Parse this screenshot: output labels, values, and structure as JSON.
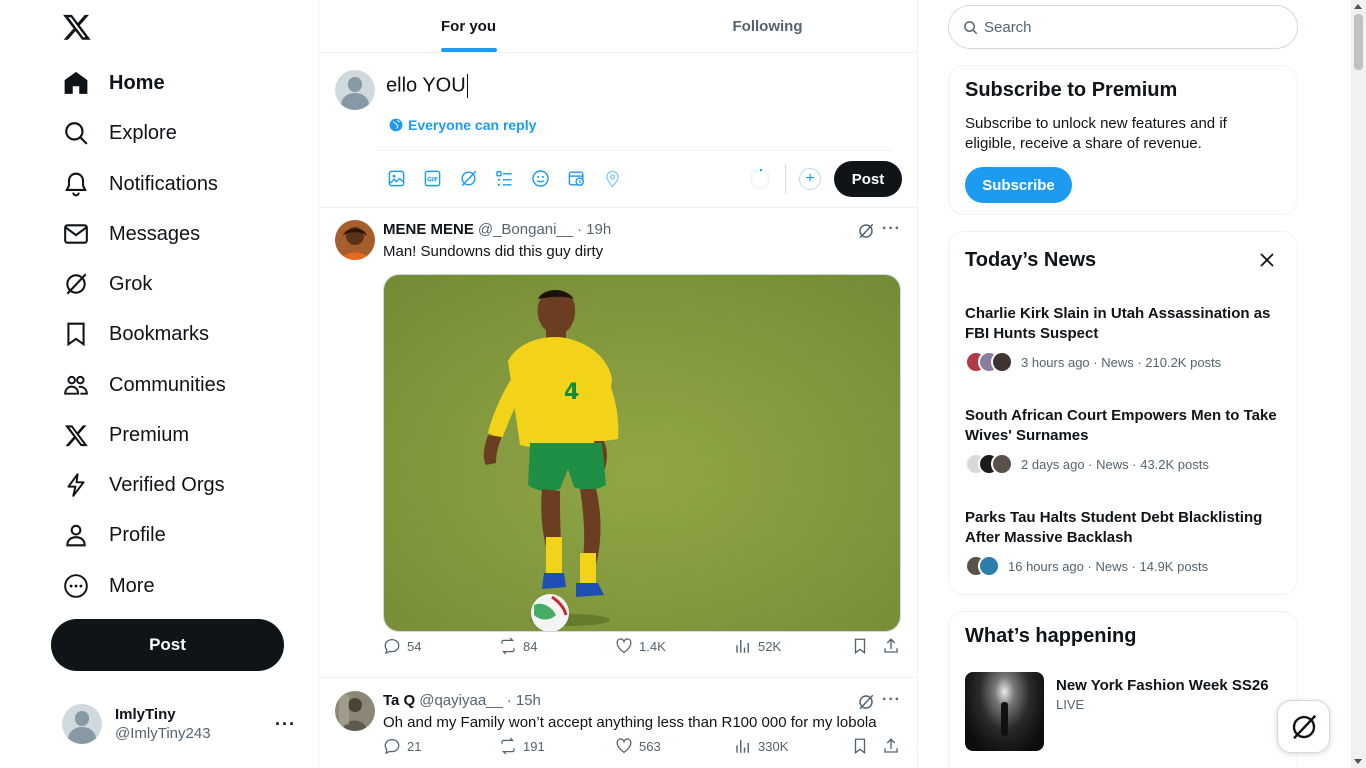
{
  "sidebar": {
    "logo": "x-logo-icon",
    "items": [
      {
        "label": "Home",
        "icon": "home-icon",
        "active": true
      },
      {
        "label": "Explore",
        "icon": "search-icon"
      },
      {
        "label": "Notifications",
        "icon": "bell-icon"
      },
      {
        "label": "Messages",
        "icon": "envelope-icon"
      },
      {
        "label": "Grok",
        "icon": "grok-icon"
      },
      {
        "label": "Bookmarks",
        "icon": "bookmark-icon"
      },
      {
        "label": "Communities",
        "icon": "people-icon"
      },
      {
        "label": "Premium",
        "icon": "x-logo-icon"
      },
      {
        "label": "Verified Orgs",
        "icon": "lightning-icon"
      },
      {
        "label": "Profile",
        "icon": "person-icon"
      },
      {
        "label": "More",
        "icon": "more-circle-icon"
      }
    ],
    "post_label": "Post",
    "account": {
      "name": "ImlyTiny",
      "handle": "@ImlyTiny243",
      "more": "···"
    }
  },
  "tabs": [
    {
      "label": "For you",
      "active": true
    },
    {
      "label": "Following",
      "active": false
    }
  ],
  "composer": {
    "text": "ello YOU",
    "reply_setting": "Everyone can reply",
    "tools": [
      "image-icon",
      "gif-icon",
      "grok-icon",
      "poll-icon",
      "emoji-icon",
      "schedule-icon",
      "location-icon"
    ],
    "add_label": "+",
    "post_label": "Post"
  },
  "tweets": [
    {
      "name": "MENE MENE",
      "handle": "@_Bongani__",
      "time": "19h",
      "text": "Man! Sundowns did this guy dirty",
      "has_media": true,
      "stats": {
        "replies": "54",
        "reposts": "84",
        "likes": "1.4K",
        "views": "52K"
      }
    },
    {
      "name": "Ta Q",
      "handle": "@qayiyaa__",
      "time": "15h",
      "text": "Oh and my Family won’t accept anything less than R100 000 for my lobola",
      "has_media": false,
      "stats": {
        "replies": "21",
        "reposts": "191",
        "likes": "563",
        "views": "330K"
      }
    }
  ],
  "search": {
    "placeholder": "Search"
  },
  "premium": {
    "title": "Subscribe to Premium",
    "description": "Subscribe to unlock new features and if eligible, receive a share of revenue.",
    "button": "Subscribe"
  },
  "news": {
    "title": "Today’s News",
    "items": [
      {
        "headline": "Charlie Kirk Slain in Utah Assassination as FBI Hunts Suspect",
        "meta": "3 hours ago · News · 210.2K posts"
      },
      {
        "headline": "South African Court Empowers Men to Take Wives' Surnames",
        "meta": "2 days ago · News · 43.2K posts"
      },
      {
        "headline": "Parks Tau Halts Student Debt Blacklisting After Massive Backlash",
        "meta": "16 hours ago · News · 14.9K posts"
      }
    ]
  },
  "happening": {
    "title": "What’s happening",
    "trend_title": "New York Fashion Week SS26",
    "trend_sub": "LIVE"
  },
  "colors": {
    "accent": "#1d9bf0",
    "text": "#0f1419",
    "muted": "#536471",
    "border": "#eff3f4"
  }
}
